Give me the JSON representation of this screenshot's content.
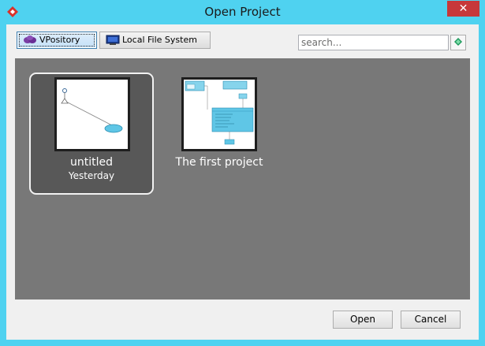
{
  "window": {
    "title": "Open Project",
    "close_glyph": "✕",
    "titlebar_color": "#4fd2f0"
  },
  "toolbar": {
    "vpository_label": "VPository",
    "local_fs_label": "Local File System"
  },
  "search": {
    "placeholder": "search..."
  },
  "projects": [
    {
      "name": "untitled",
      "date": "Yesterday",
      "selected": true
    },
    {
      "name": "The first project",
      "date": "",
      "selected": false
    }
  ],
  "buttons": {
    "open_label": "Open",
    "cancel_label": "Cancel"
  },
  "icons": {
    "app": "app-icon",
    "vpository": "vpository-icon",
    "local_fs": "monitor-icon",
    "search": "search-icon"
  }
}
